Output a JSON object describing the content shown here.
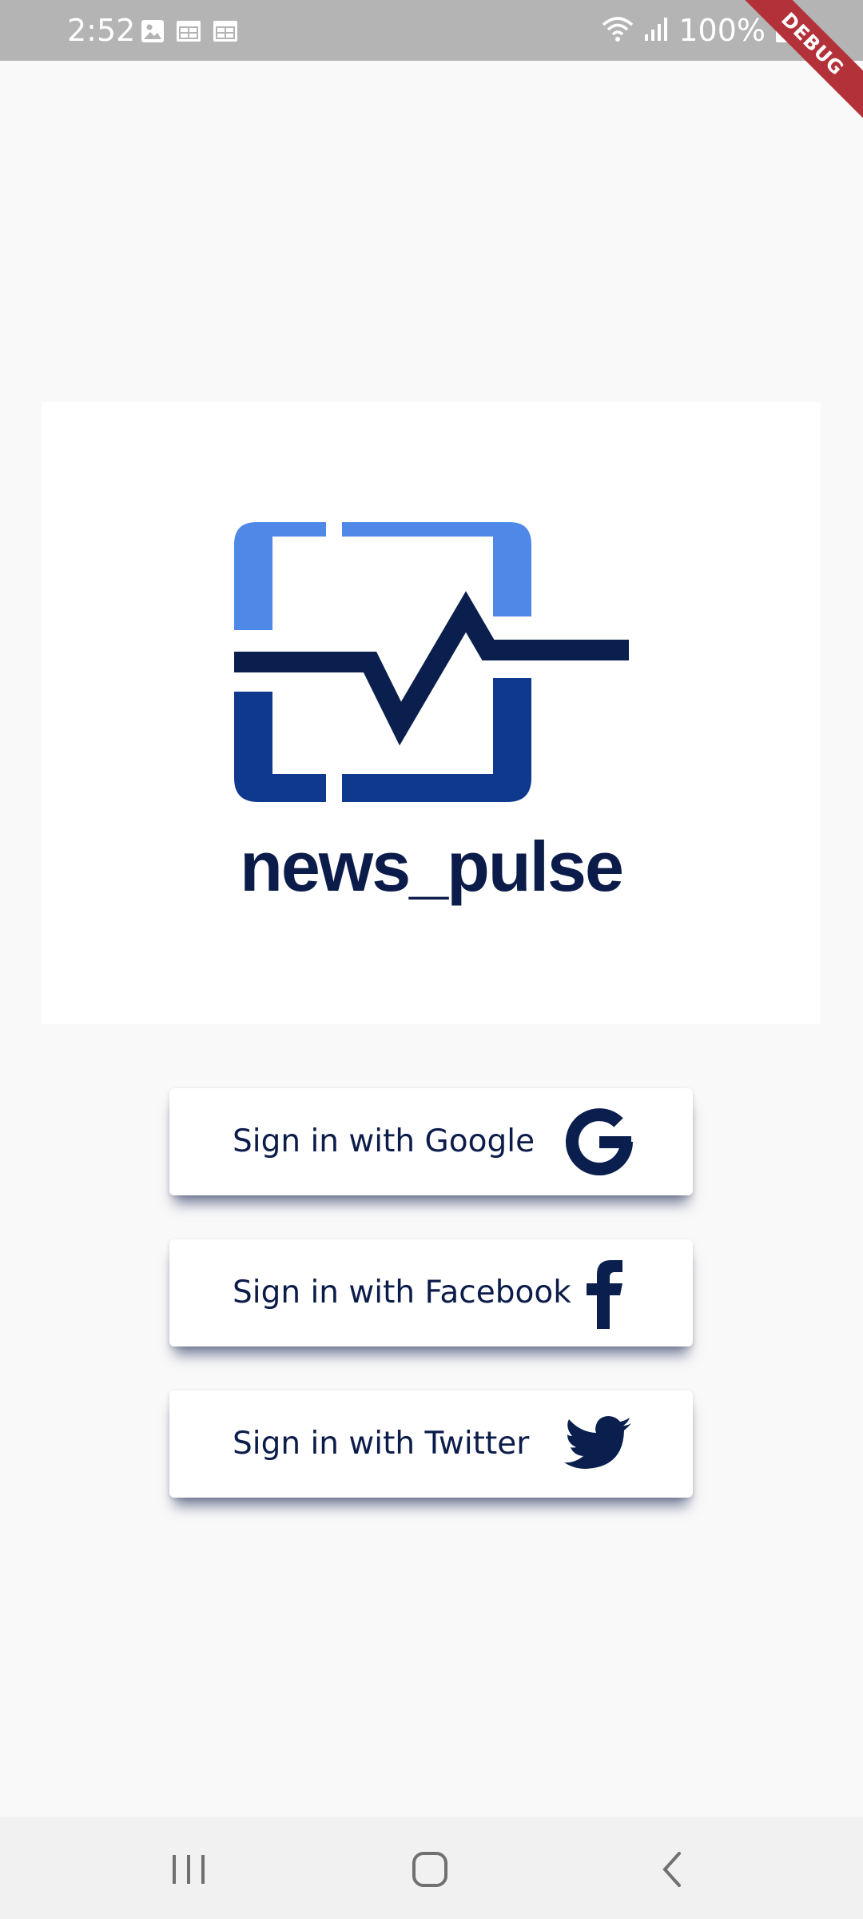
{
  "status_bar": {
    "time": "2:52",
    "battery_percent": "100%",
    "left_icons": [
      "image-icon",
      "calendar-icon",
      "calendar-icon"
    ],
    "right_icons": [
      "wifi-icon",
      "signal-icon",
      "battery-icon"
    ]
  },
  "debug_banner": {
    "label": "DEBUG"
  },
  "logo": {
    "app_name": "news_pulse",
    "icon": "pulse-frame-logo-icon"
  },
  "sign_in": {
    "google": {
      "label": "Sign in with Google",
      "icon": "google-icon"
    },
    "facebook": {
      "label": "Sign in with Facebook",
      "icon": "facebook-icon"
    },
    "twitter": {
      "label": "Sign in with Twitter",
      "icon": "twitter-icon"
    }
  },
  "nav_bar": {
    "icons": [
      "recent-apps-icon",
      "home-icon",
      "back-icon"
    ]
  },
  "colors": {
    "navy": "#0c1c4a",
    "logo_light_blue": "#5088e8",
    "logo_dark_blue": "#0f398c",
    "status_bar": "#b4b4b4",
    "background": "#f9f9f9"
  }
}
